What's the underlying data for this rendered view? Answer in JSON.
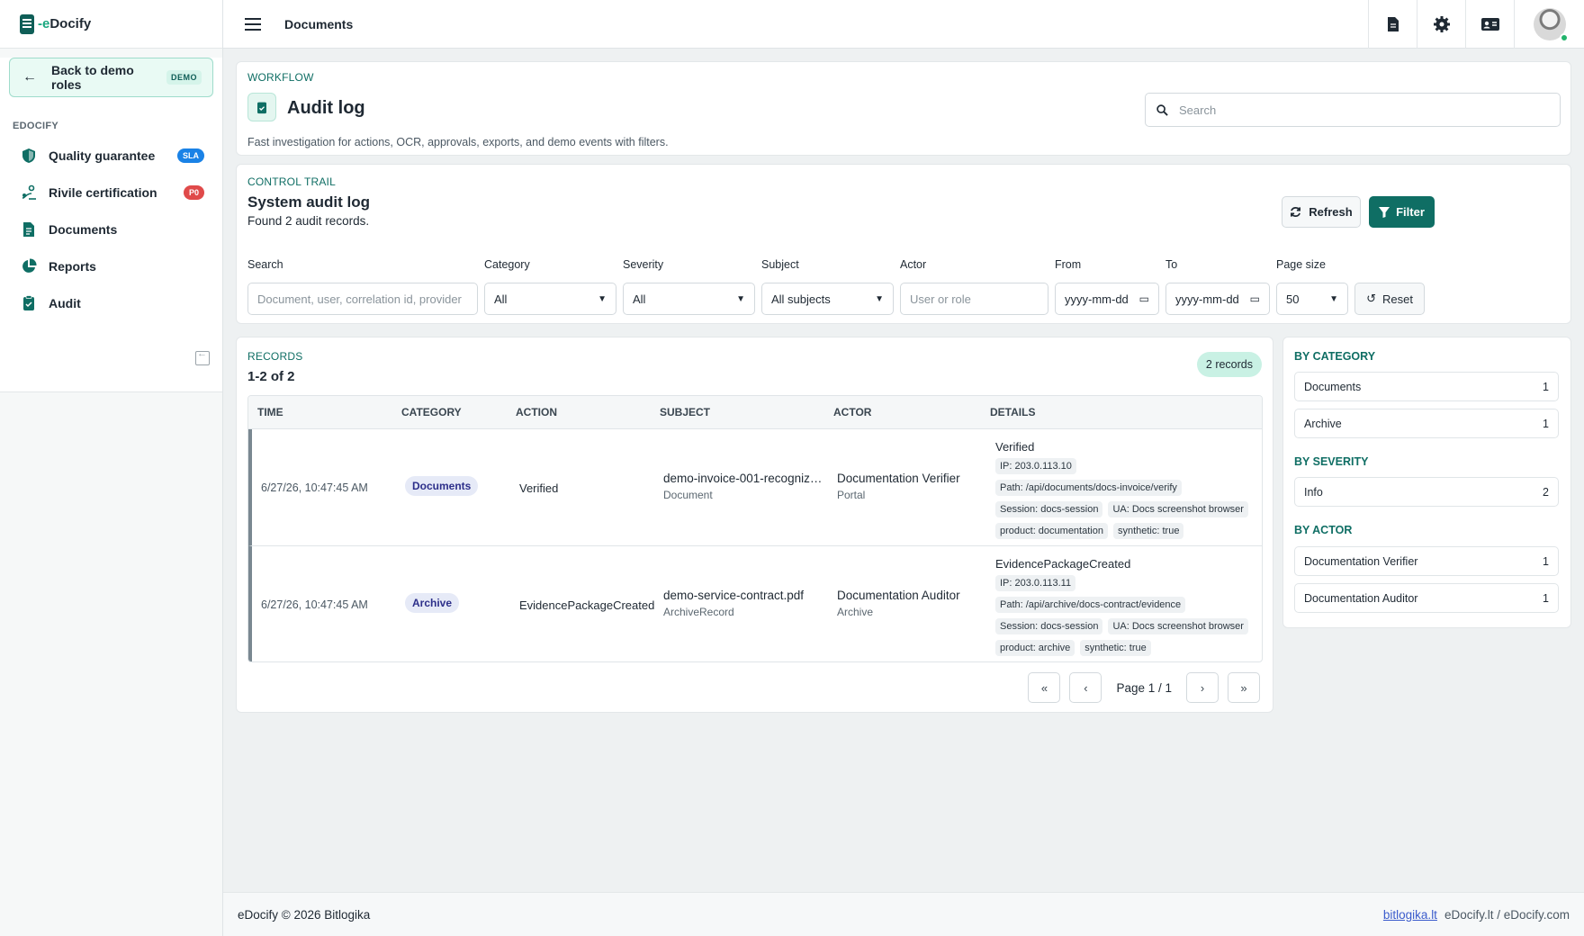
{
  "app": {
    "brand": "eDocify",
    "brand_prefix": "e",
    "brand_rest": "Docify",
    "accent": "#0f6e64"
  },
  "sidebar": {
    "back_label": "Back to demo roles",
    "back_badge": "DEMO",
    "section": "EDOCIFY",
    "items": [
      {
        "label": "Quality guarantee",
        "badge": "SLA",
        "icon": "shield-icon"
      },
      {
        "label": "Rivile certification",
        "badge": "P0",
        "icon": "certification-icon"
      },
      {
        "label": "Documents",
        "icon": "document-icon"
      },
      {
        "label": "Reports",
        "icon": "pie-chart-icon"
      },
      {
        "label": "Audit",
        "icon": "clipboard-check-icon"
      }
    ]
  },
  "topbar": {
    "title": "Documents"
  },
  "header": {
    "eyebrow": "WORKFLOW",
    "title": "Audit log",
    "description": "Fast investigation for actions, OCR, approvals, exports, and demo events with filters.",
    "search_placeholder": "Search"
  },
  "control": {
    "eyebrow": "CONTROL TRAIL",
    "title": "System audit log",
    "found": "Found 2 audit records.",
    "refresh": "Refresh",
    "filter": "Filter",
    "reset": "Reset",
    "filters": {
      "search_label": "Search",
      "search_placeholder": "Document, user, correlation id, provider",
      "category_label": "Category",
      "category_value": "All",
      "severity_label": "Severity",
      "severity_value": "All",
      "subject_label": "Subject",
      "subject_value": "All subjects",
      "actor_label": "Actor",
      "actor_placeholder": "User or role",
      "from_label": "From",
      "from_placeholder": "yyyy-mm-dd",
      "to_label": "To",
      "to_placeholder": "yyyy-mm-dd",
      "pagesize_label": "Page size",
      "pagesize_value": "50"
    }
  },
  "records": {
    "eyebrow": "RECORDS",
    "range": "1-2 of 2",
    "count": "2 records",
    "columns": [
      "TIME",
      "CATEGORY",
      "ACTION",
      "SUBJECT",
      "ACTOR",
      "DETAILS"
    ],
    "rows": [
      {
        "time": "6/27/26, 10:47:45 AM",
        "category": "Documents",
        "action": "Verified",
        "subject": "demo-invoice-001-recognize...",
        "subject_type": "Document",
        "actor": "Documentation Verifier",
        "actor_sub": "Portal",
        "detail_title": "Verified",
        "ip": "IP: 203.0.113.10",
        "path": "Path: /api/documents/docs-invoice/verify",
        "session": "Session: docs-session",
        "ua": "UA: Docs screenshot browser",
        "product": "product: documentation",
        "synthetic": "synthetic: true"
      },
      {
        "time": "6/27/26, 10:47:45 AM",
        "category": "Archive",
        "action": "EvidencePackageCreated",
        "subject": "demo-service-contract.pdf",
        "subject_type": "ArchiveRecord",
        "actor": "Documentation Auditor",
        "actor_sub": "Archive",
        "detail_title": "EvidencePackageCreated",
        "ip": "IP: 203.0.113.11",
        "path": "Path: /api/archive/docs-contract/evidence",
        "session": "Session: docs-session",
        "ua": "UA: Docs screenshot browser",
        "product": "product: archive",
        "synthetic": "synthetic: true"
      }
    ],
    "page": "Page 1 / 1"
  },
  "summary": {
    "by_category": "BY CATEGORY",
    "categories": [
      {
        "label": "Documents",
        "n": "1"
      },
      {
        "label": "Archive",
        "n": "1"
      }
    ],
    "by_severity": "BY SEVERITY",
    "severities": [
      {
        "label": "Info",
        "n": "2"
      }
    ],
    "by_actor": "BY ACTOR",
    "actors": [
      {
        "label": "Documentation Verifier",
        "n": "1"
      },
      {
        "label": "Documentation Auditor",
        "n": "1"
      }
    ]
  },
  "footer": {
    "left": "eDocify © 2026 Bitlogika",
    "link": "bitlogika.lt",
    "right": "eDocify.lt / eDocify.com"
  }
}
